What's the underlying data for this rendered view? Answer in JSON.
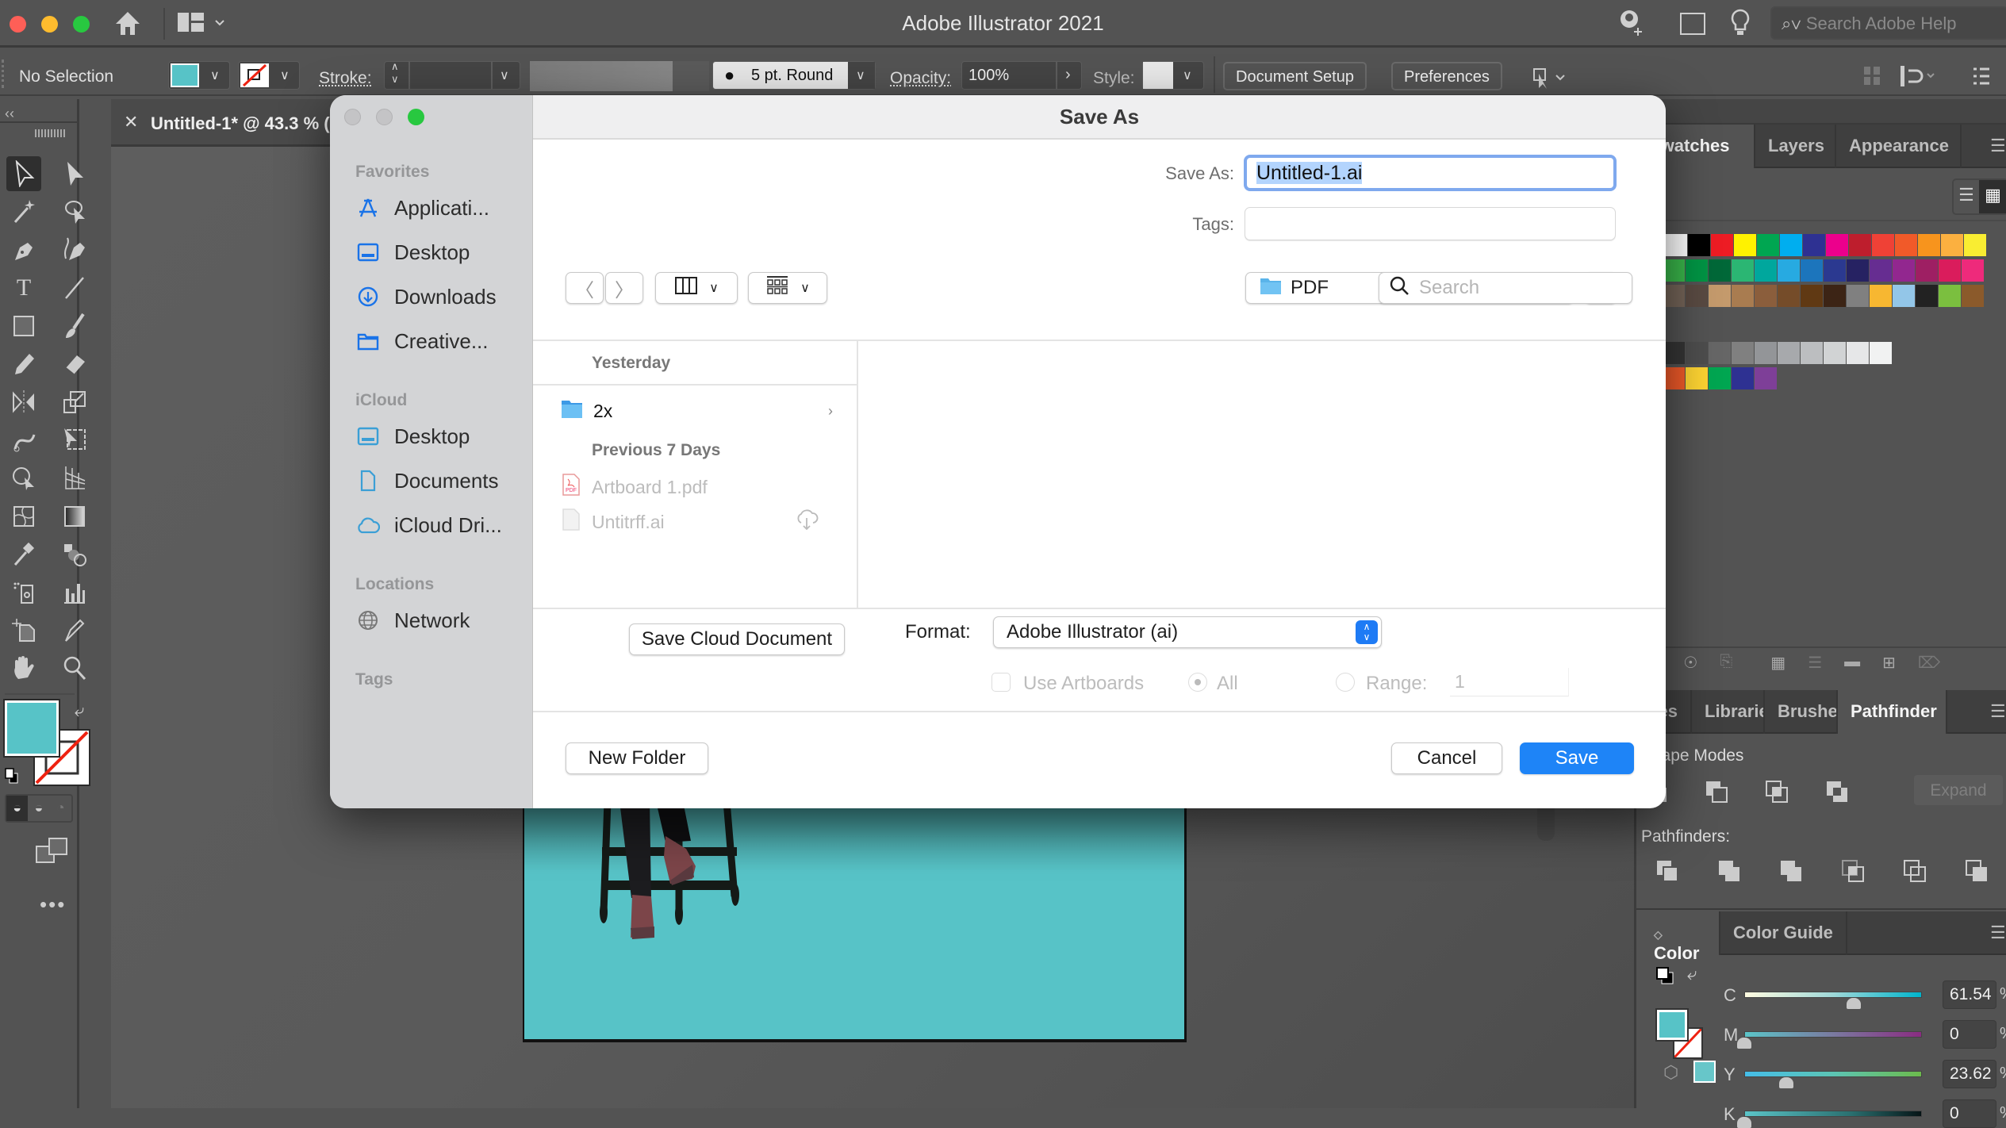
{
  "app": {
    "title": "Adobe Illustrator 2021",
    "help_search_placeholder": "Search Adobe Help"
  },
  "control_bar": {
    "selection": "No Selection",
    "fill_color": "#57c3c7",
    "stroke_label": "Stroke:",
    "brush_label": "5 pt. Round",
    "opacity_label": "Opacity:",
    "opacity_value": "100%",
    "style_label": "Style:",
    "document_setup": "Document Setup",
    "preferences": "Preferences"
  },
  "document_tab": {
    "label": "Untitled-1* @ 43.3 % ("
  },
  "tools": [
    "selection",
    "direct-selection",
    "magic-wand",
    "lasso",
    "pen",
    "curvature",
    "type",
    "line-segment",
    "rectangle",
    "paintbrush",
    "pencil",
    "eraser",
    "reflect",
    "scale",
    "warp",
    "free-transform",
    "shape-builder",
    "perspective-grid",
    "mesh",
    "gradient",
    "eyedropper",
    "blend",
    "symbol-sprayer",
    "column-graph",
    "artboard",
    "slice",
    "hand",
    "zoom"
  ],
  "dialog": {
    "title": "Save As",
    "save_as_label": "Save As:",
    "filename": "Untitled-1.ai",
    "tags_label": "Tags:",
    "tags_value": "",
    "location": "PDF",
    "search_placeholder": "Search",
    "sidebar": {
      "sections": [
        {
          "heading": "Favorites",
          "items": [
            {
              "label": "Applicati...",
              "icon": "applications-icon"
            },
            {
              "label": "Desktop",
              "icon": "desktop-icon"
            },
            {
              "label": "Downloads",
              "icon": "downloads-icon"
            },
            {
              "label": "Creative...",
              "icon": "folder-icon"
            }
          ]
        },
        {
          "heading": "iCloud",
          "items": [
            {
              "label": "Desktop",
              "icon": "desktop-icon"
            },
            {
              "label": "Documents",
              "icon": "document-icon"
            },
            {
              "label": "iCloud Dri...",
              "icon": "cloud-icon"
            }
          ]
        },
        {
          "heading": "Locations",
          "items": [
            {
              "label": "Network",
              "icon": "globe-icon"
            }
          ]
        },
        {
          "heading": "Tags",
          "items": []
        }
      ]
    },
    "files": {
      "groups": [
        {
          "heading": "Yesterday",
          "items": [
            {
              "name": "2x",
              "type": "folder",
              "enabled": true
            }
          ]
        },
        {
          "heading": "Previous 7 Days",
          "items": [
            {
              "name": "Artboard 1.pdf",
              "type": "pdf",
              "enabled": false
            },
            {
              "name": "Untitrff.ai",
              "type": "ai",
              "enabled": false,
              "cloud": true
            }
          ]
        }
      ]
    },
    "save_cloud_document": "Save Cloud Document",
    "format_label": "Format:",
    "format_value": "Adobe Illustrator (ai)",
    "use_artboards_label": "Use Artboards",
    "use_artboards_checked": false,
    "all_label": "All",
    "range_label": "Range:",
    "range_value": "1",
    "new_folder": "New Folder",
    "cancel": "Cancel",
    "save": "Save"
  },
  "right_panel": {
    "top_tabs": [
      "Swatches",
      "Layers",
      "Appearance"
    ],
    "swatch_rows": [
      [
        "#ffffff",
        "#000000",
        "#ed1c24",
        "#fff200",
        "#00a651",
        "#00aeef",
        "#2e3192",
        "#ec008c",
        "#be1e2d",
        "#ef4136",
        "#f15a29",
        "#f7941d",
        "#fbb040",
        "#f9ed32"
      ],
      [
        "#8dc63f",
        "#39b54a",
        "#009444",
        "#006838",
        "#2bb673",
        "#00a79d",
        "#27aae1",
        "#1c75bc",
        "#2b3990",
        "#262262",
        "#662d91",
        "#92278f",
        "#9e1f63",
        "#da1c5c",
        "#ee2a7b"
      ],
      [
        "#8b7363",
        "#736357",
        "#594a42",
        "#c49a6c",
        "#a97c50",
        "#8b5e3c",
        "#754c29",
        "#603913",
        "#3c2415",
        "#808080",
        "#f7b731",
        "#93c6e8",
        "#222222",
        "#7bbf3f",
        "#8b5a2b"
      ],
      [
        "#3a8a8a"
      ],
      [
        "#000000",
        "#353535",
        "#4d4d4d",
        "#666666",
        "#808080",
        "#939598",
        "#a7a9ac",
        "#bcbec0",
        "#d1d3d4",
        "#e6e7e8",
        "#f1f2f2"
      ],
      [
        "#be1e2d",
        "#f15a29",
        "#fbd232",
        "#00a651",
        "#2e3192",
        "#7e3f98"
      ]
    ],
    "bottom_tabs": [
      "Properties",
      "Libraries",
      "Brushes",
      "Pathfinder"
    ],
    "shape_modes_label": "Shape Modes:",
    "expand_label": "Expand",
    "pathfinders_label": "Pathfinders:",
    "color_tabs": [
      "Color",
      "Color Guide"
    ],
    "color": {
      "channels": [
        {
          "name": "C",
          "value": "61.54",
          "fraction": 0.6154
        },
        {
          "name": "M",
          "value": "0",
          "fraction": 0
        },
        {
          "name": "Y",
          "value": "23.62",
          "fraction": 0.2362
        },
        {
          "name": "K",
          "value": "0",
          "fraction": 0
        }
      ],
      "unit": "%"
    }
  }
}
